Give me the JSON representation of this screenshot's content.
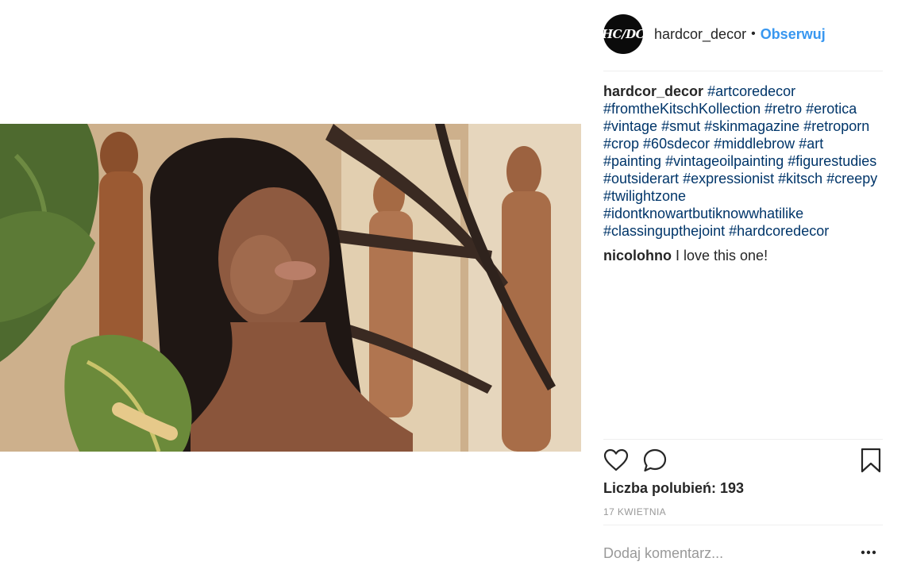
{
  "post": {
    "image_description": "",
    "header": {
      "avatar_text": "HC/DC",
      "username": "hardcor_decor",
      "separator": "•",
      "follow_label": "Obserwuj"
    },
    "caption": {
      "username": "hardcor_decor",
      "tags": [
        "#artcoredecor",
        "#fromtheKitschKollection",
        "#retro",
        "#erotica",
        "#vintage",
        "#smut",
        "#skinmagazine",
        "#retroporn",
        "#crop",
        "#60sdecor",
        "#middlebrow",
        "#art",
        "#painting",
        "#vintageoilpainting",
        "#figurestudies",
        "#outsiderart",
        "#expressionist",
        "#kitsch",
        "#creepy",
        "#twilightzone",
        "#idontknowartbutiknowwhatilike",
        "#classingupthejoint",
        "#hardcoredecor"
      ]
    },
    "comment": {
      "username": "nicolohno",
      "text": "I love this one!"
    },
    "actions": {
      "like_icon": "heart-icon",
      "comment_icon": "comment-bubble-icon",
      "save_icon": "bookmark-icon"
    },
    "likes_text": "Liczba polubień: 193",
    "date": "17 KWIETNIA",
    "add_comment_placeholder": "Dodaj komentarz...",
    "more_icon": "more-options-icon"
  },
  "colors": {
    "link": "#003569",
    "follow": "#3897f0",
    "muted": "#999999",
    "text": "#262626"
  }
}
